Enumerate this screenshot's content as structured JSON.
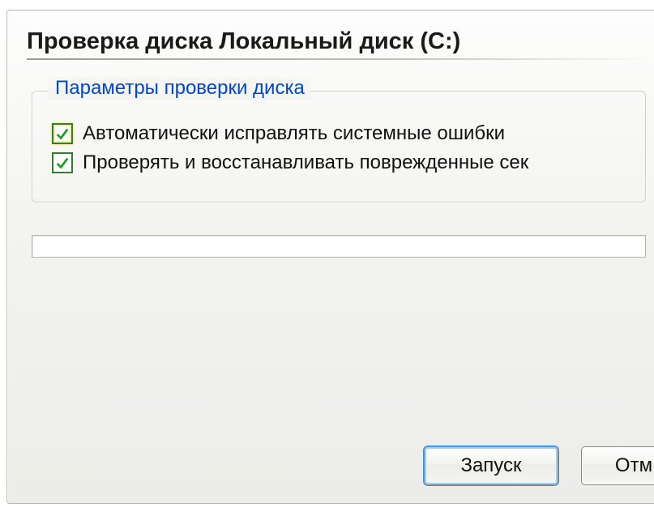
{
  "window": {
    "title": "Проверка диска Локальный диск (C:)"
  },
  "groupbox": {
    "legend": "Параметры проверки диска",
    "options": [
      {
        "label": "Автоматически исправлять системные ошибки",
        "checked": true
      },
      {
        "label": "Проверять и восстанавливать поврежденные сек",
        "checked": true
      }
    ]
  },
  "buttons": {
    "start": "Запуск",
    "cancel": "Отм"
  }
}
